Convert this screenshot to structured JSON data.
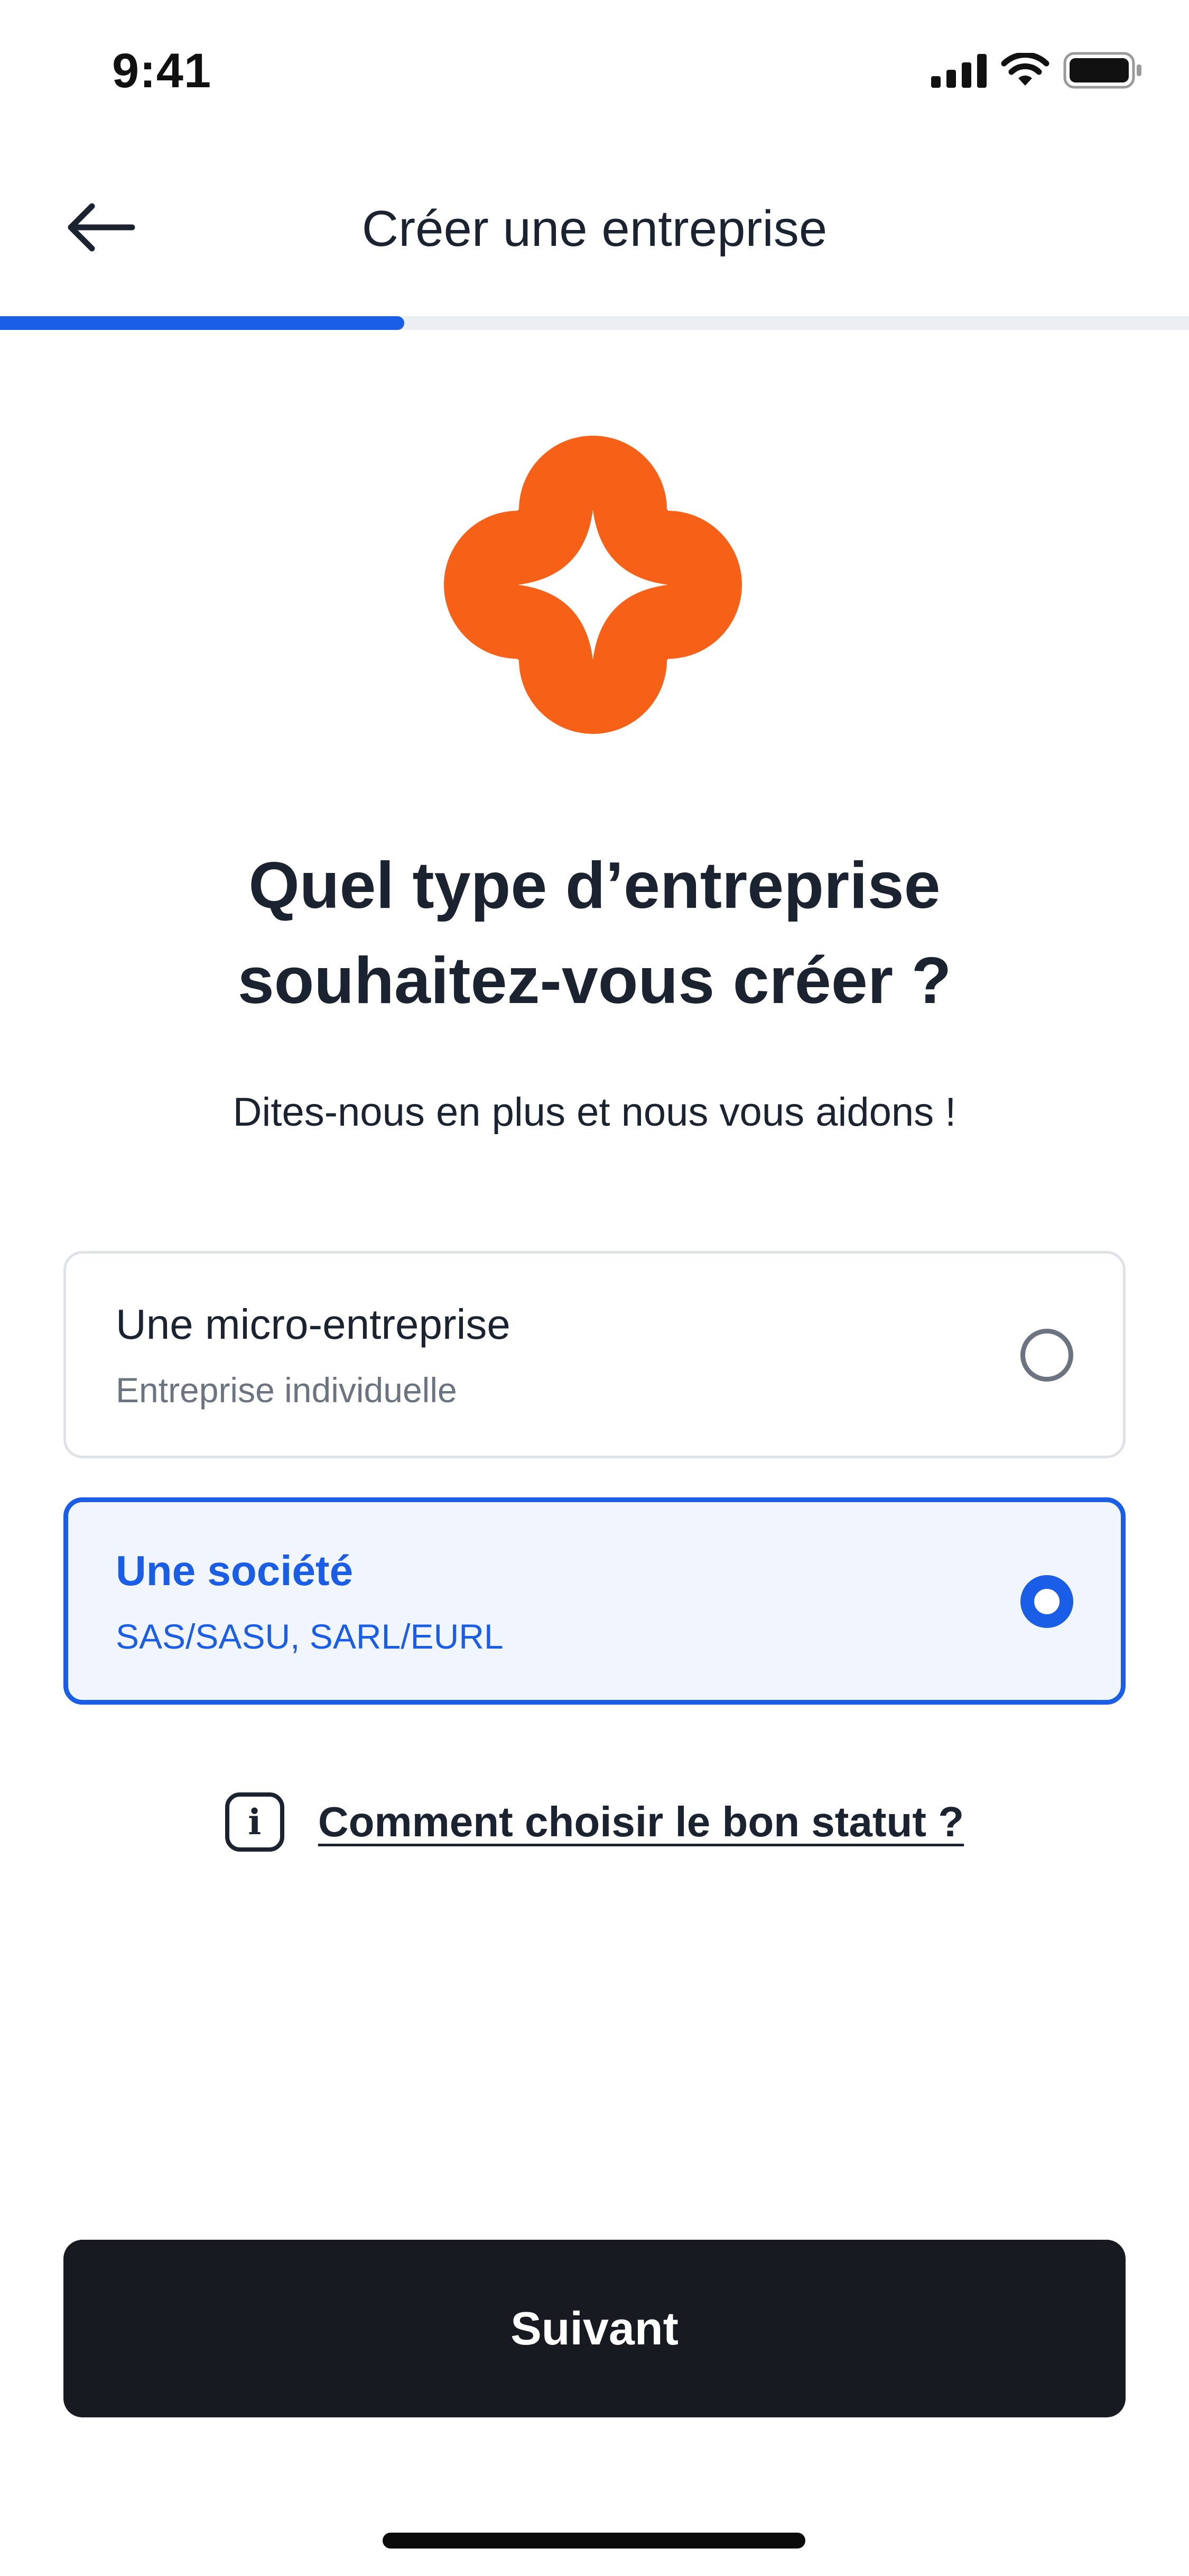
{
  "status_bar": {
    "time": "9:41",
    "icons": [
      "cellular-signal-icon",
      "wifi-icon",
      "battery-icon"
    ]
  },
  "header": {
    "back_icon": "arrow-left-icon",
    "title": "Créer une entreprise"
  },
  "progress": {
    "fraction": 0.34,
    "fill_color": "#1a5ee8"
  },
  "logo": {
    "icon": "flower-sparkle-logo",
    "color": "#f76117"
  },
  "main": {
    "question_line1": "Quel type d’entreprise",
    "question_line2": "souhaitez-vous créer ?",
    "subtitle": "Dites-nous en plus et nous vous aidons !"
  },
  "options": [
    {
      "title": "Une micro-entreprise",
      "subtitle": "Entreprise individuelle",
      "selected": false
    },
    {
      "title": "Une société",
      "subtitle": "SAS/SASU, SARL/EURL",
      "selected": true
    }
  ],
  "help": {
    "icon": "info-icon",
    "icon_glyph": "i",
    "link_text": "Comment choisir le bon statut ?"
  },
  "footer": {
    "next_label": "Suivant"
  },
  "colors": {
    "accent": "#1a5ee8",
    "brand": "#f76117",
    "button_dark": "#171a20"
  }
}
